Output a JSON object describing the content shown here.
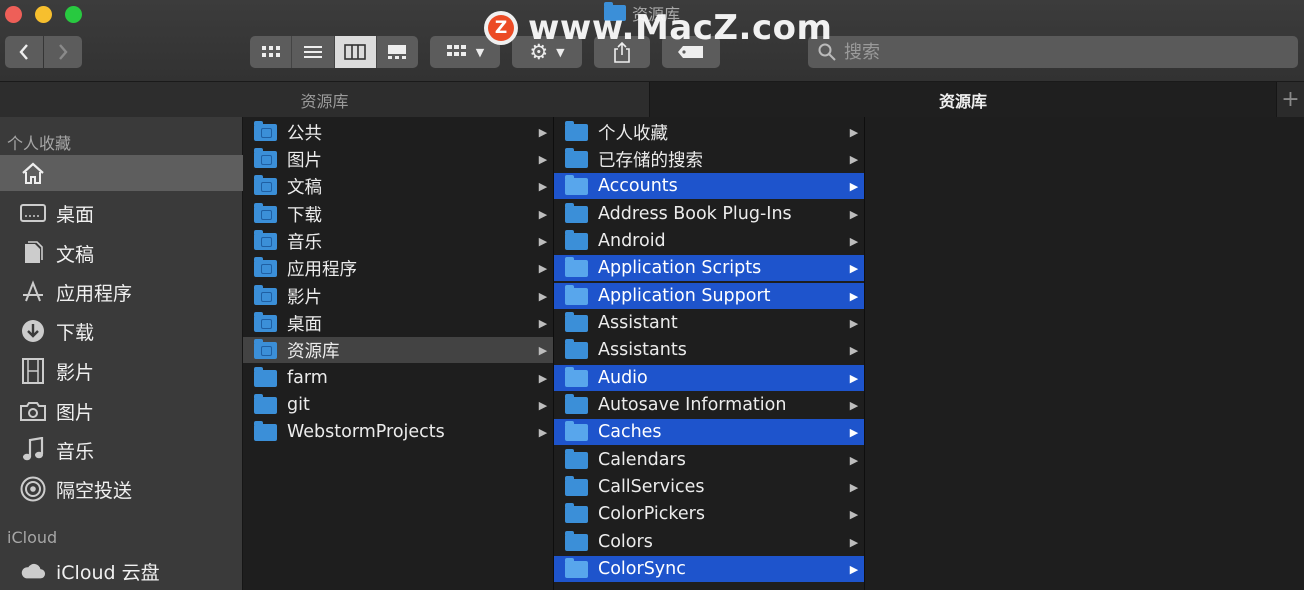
{
  "window": {
    "title": "资源库"
  },
  "watermark": {
    "badge": "Z",
    "text": "www.MacZ.com"
  },
  "toolbar": {
    "back_icon": "chevron-left-icon",
    "forward_icon": "chevron-right-icon",
    "views": [
      "icon-view",
      "list-view",
      "column-view",
      "gallery-view"
    ],
    "active_view": "column-view",
    "search_placeholder": "搜索"
  },
  "path_tabs": [
    {
      "label": "资源库",
      "active": false
    },
    {
      "label": "资源库",
      "active": true
    }
  ],
  "sidebar": {
    "favorites_header": "个人收藏",
    "favorites": [
      {
        "label": "",
        "icon": "home-icon",
        "selected": true
      },
      {
        "label": "桌面",
        "icon": "desktop-icon"
      },
      {
        "label": "文稿",
        "icon": "documents-icon"
      },
      {
        "label": "应用程序",
        "icon": "applications-icon"
      },
      {
        "label": "下载",
        "icon": "download-icon"
      },
      {
        "label": "影片",
        "icon": "movies-icon"
      },
      {
        "label": "图片",
        "icon": "pictures-icon"
      },
      {
        "label": "音乐",
        "icon": "music-icon"
      },
      {
        "label": "隔空投送",
        "icon": "airdrop-icon"
      }
    ],
    "icloud_header": "iCloud",
    "icloud": [
      {
        "label": "iCloud 云盘",
        "icon": "cloud-icon"
      }
    ]
  },
  "columns": [
    {
      "items": [
        {
          "label": "公共"
        },
        {
          "label": "图片"
        },
        {
          "label": "文稿"
        },
        {
          "label": "下载"
        },
        {
          "label": "音乐"
        },
        {
          "label": "应用程序"
        },
        {
          "label": "影片"
        },
        {
          "label": "桌面"
        },
        {
          "label": "资源库",
          "selected": true
        },
        {
          "label": "farm"
        },
        {
          "label": "git"
        },
        {
          "label": "WebstormProjects"
        }
      ]
    },
    {
      "items": [
        {
          "label": "个人收藏"
        },
        {
          "label": "已存储的搜索"
        },
        {
          "label": "Accounts",
          "highlighted": true
        },
        {
          "label": "Address Book Plug-Ins"
        },
        {
          "label": "Android"
        },
        {
          "label": "Application Scripts",
          "highlighted": true
        },
        {
          "label": "Application Support",
          "highlighted": true
        },
        {
          "label": "Assistant"
        },
        {
          "label": "Assistants"
        },
        {
          "label": "Audio",
          "highlighted": true
        },
        {
          "label": "Autosave Information"
        },
        {
          "label": "Caches",
          "highlighted": true
        },
        {
          "label": "Calendars"
        },
        {
          "label": "CallServices"
        },
        {
          "label": "ColorPickers"
        },
        {
          "label": "Colors"
        },
        {
          "label": "ColorSync",
          "highlighted": true
        }
      ]
    }
  ],
  "colors": {
    "highlight": "#1e54cc",
    "folder": "#3b8fd8",
    "sidebar_bg": "#3a3a3a"
  }
}
